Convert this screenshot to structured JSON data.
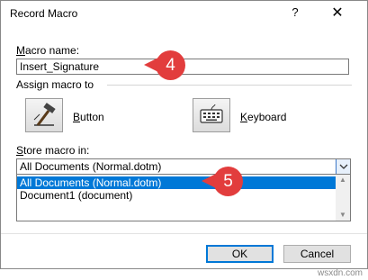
{
  "window": {
    "title": "Record Macro",
    "help_glyph": "?",
    "close_glyph": "✕"
  },
  "macro_name": {
    "label_key": "M",
    "label_rest": "acro name:",
    "value": "Insert_Signature"
  },
  "assign": {
    "label": "Assign macro to",
    "button": {
      "label_key": "B",
      "label_rest": "utton",
      "icon": "hammer-icon"
    },
    "keyboard": {
      "label_key": "K",
      "label_rest": "eyboard",
      "icon": "keyboard-icon"
    }
  },
  "store": {
    "label_key": "S",
    "label_rest": "tore macro in:",
    "selected": "All Documents (Normal.dotm)",
    "options": [
      "All Documents (Normal.dotm)",
      "Document1 (document)"
    ]
  },
  "footer": {
    "ok_label": "OK",
    "cancel_label": "Cancel"
  },
  "callouts": {
    "first": "4",
    "second": "5",
    "color": "#e23d3d"
  },
  "watermark": "wsxdn.com",
  "colors": {
    "selection": "#0078d7",
    "default_button_border": "#0078d7"
  }
}
